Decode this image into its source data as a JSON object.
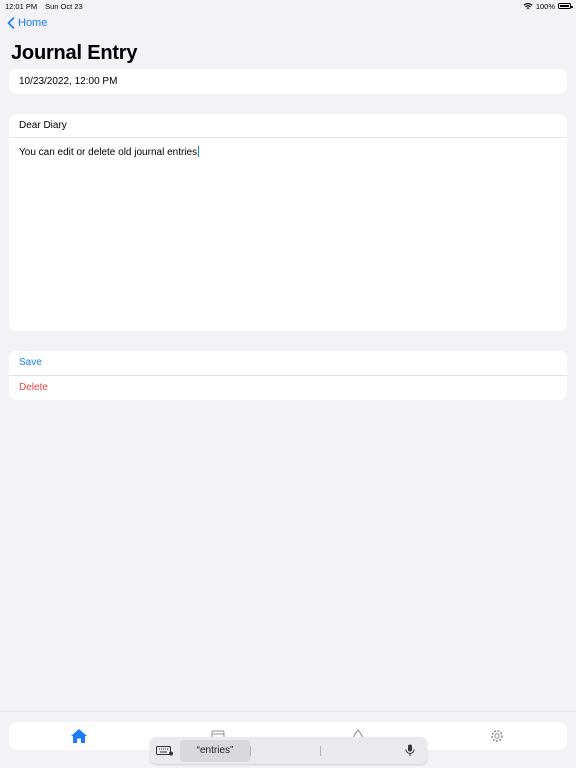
{
  "status_bar": {
    "time": "12:01 PM",
    "date": "Sun Oct 23",
    "battery": "100%"
  },
  "nav": {
    "back_label": "Home",
    "title": "Journal Entry"
  },
  "entry": {
    "date_value": "10/23/2022, 12:00 PM",
    "subject": "Dear Diary",
    "body": "You can edit or delete old journal entries"
  },
  "actions": {
    "save_label": "Save",
    "delete_label": "Delete"
  },
  "tabs": [
    "home-icon",
    "calendar-icon",
    "drop-icon",
    "gear-icon"
  ],
  "keyboard_bar": {
    "suggestion": "“entries”"
  },
  "colors": {
    "accent": "#1a7cf5",
    "destructive": "#e8453c",
    "background": "#f2f2f7"
  }
}
